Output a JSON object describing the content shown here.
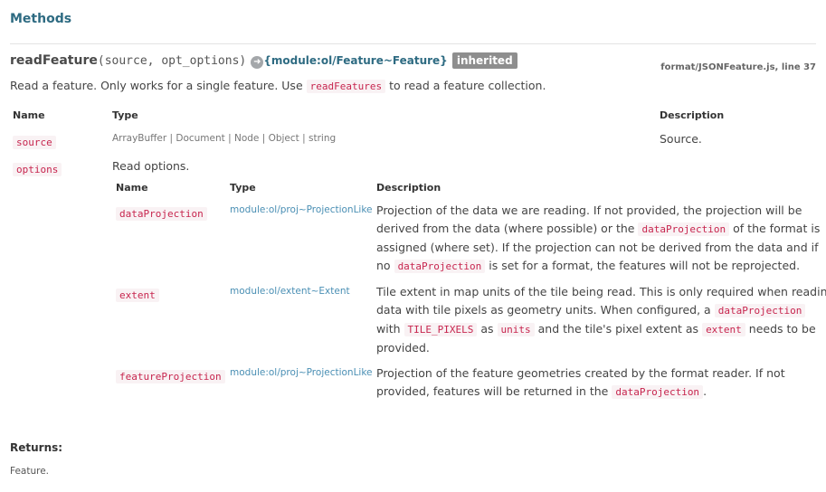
{
  "section_title": "Methods",
  "method": {
    "name": "readFeature",
    "signature": "(source, opt_options)",
    "link_icon": "link-arrow-icon",
    "return_type": "{module:ol/Feature~Feature}",
    "badge": "inherited",
    "source_ref": "format/JSONFeature.js, line 37",
    "desc_pre": "Read a feature. Only works for a single feature. Use",
    "desc_code": "readFeatures",
    "desc_post": "to read a feature collection."
  },
  "params_table": {
    "headers": {
      "name": "Name",
      "type": "Type",
      "description": "Description"
    },
    "rows": [
      {
        "name": "source",
        "type": "ArrayBuffer | Document | Node | Object | string",
        "description": "Source."
      },
      {
        "name": "options",
        "description": "Read options."
      }
    ]
  },
  "options_table": {
    "headers": {
      "name": "Name",
      "type": "Type",
      "description": "Description"
    },
    "rows": [
      {
        "name": "dataProjection",
        "type": "module:ol/proj~ProjectionLike",
        "d1": "Projection of the data we are reading. If not provided, the projection will be",
        "d2a": "derived from the data (where possible) or the",
        "d2code": "dataProjection",
        "d2b": "of the format is",
        "d3": "assigned (where set). If the projection can not be derived from the data and if",
        "d4a": "no",
        "d4code": "dataProjection",
        "d4b": "is set for a format, the features will not be reprojected."
      },
      {
        "name": "extent",
        "type": "module:ol/extent~Extent",
        "d1": "Tile extent in map units of the tile being read. This is only required when reading",
        "d2a": "data with tile pixels as geometry units. When configured, a",
        "d2code": "dataProjection",
        "d3a": "with",
        "d3code1": "TILE_PIXELS",
        "d3b": "as",
        "d3code2": "units",
        "d3c": "and the tile's pixel extent as",
        "d3code3": "extent",
        "d3d": "needs to be",
        "d4": "provided."
      },
      {
        "name": "featureProjection",
        "type": "module:ol/proj~ProjectionLike",
        "d1": "Projection of the feature geometries created by the format reader. If not",
        "d2a": "provided, features will be returned in the",
        "d2code": "dataProjection",
        "d2b": "."
      }
    ]
  },
  "returns": {
    "label": "Returns:",
    "value": "Feature."
  }
}
